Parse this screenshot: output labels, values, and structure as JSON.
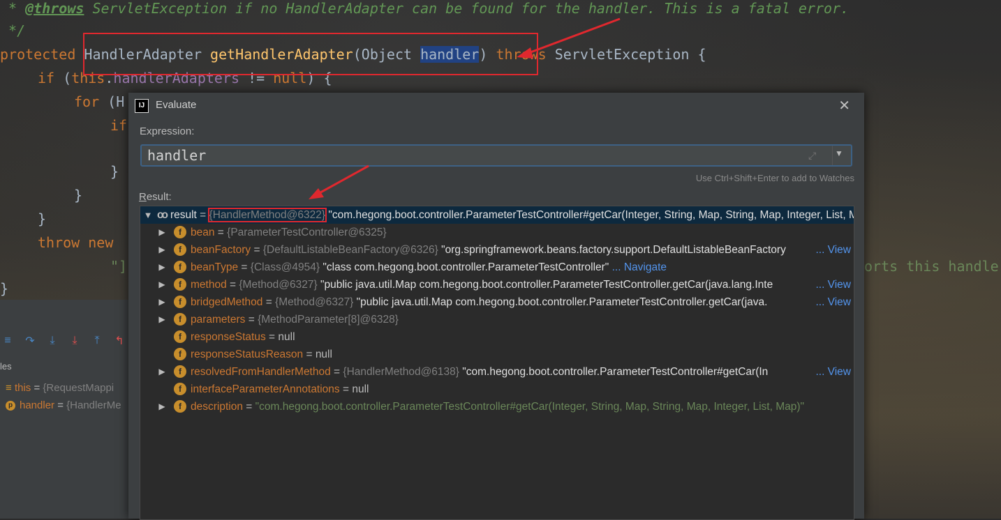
{
  "code": {
    "line1_star": " * ",
    "line1_tag": "@throws",
    "line1_rest": " ServletException if no HandlerAdapter can be found for the handler. This is a fatal error.",
    "line2": " */",
    "line3_kw": "protected",
    "line3_type": " HandlerAdapter ",
    "line3_fn": "getHandlerAdapter",
    "line3_params_open": "(Object ",
    "line3_sel": "handler",
    "line3_close": ") ",
    "line3_throws": "throws",
    "line3_end": " ServletException {",
    "line4_if": "if",
    "line4_mid": " (",
    "line4_this": "this",
    "line4_dot": ".",
    "line4_field": "handlerAdapters",
    "line4_ne": " != ",
    "line4_null": "null",
    "line4_end": ") {",
    "line5_for": "for",
    "line5_rest": " (H",
    "line6_if": "if",
    "line7": "}",
    "line8": "}",
    "line9": "}",
    "line10_throw": "throw",
    "line10_new": "new",
    "line11": "\"]",
    "line11_right": "orts this handle",
    "line12": "}"
  },
  "debug": {
    "vars_header": "les",
    "var_this_name": "this",
    "var_this_eq": " = ",
    "var_this_val": "{RequestMappi",
    "var_handler_name": "handler",
    "var_handler_eq": " = ",
    "var_handler_val": "{HandlerMe"
  },
  "dialog": {
    "title": "Evaluate",
    "logo": "IJ",
    "expression_label": "Expression:",
    "expression_value": "handler",
    "hint": "Use Ctrl+Shift+Enter to add to Watches",
    "result_label_u": "R",
    "result_label_rest": "esult:"
  },
  "tree": {
    "root": {
      "name": "result",
      "eq": " = ",
      "ref": "{HandlerMethod@6322}",
      "value": " \"com.hegong.boot.controller.ParameterTestController#getCar(Integer, String, Map, String, Map, Integer, List, Map)\""
    },
    "rows": [
      {
        "name": "bean",
        "ref": "{ParameterTestController@6325}",
        "value": "",
        "link": "",
        "expandable": true
      },
      {
        "name": "beanFactory",
        "ref": "{DefaultListableBeanFactory@6326}",
        "value": " \"org.springframework.beans.factory.support.DefaultListableBeanFactory",
        "link": "... View",
        "expandable": true
      },
      {
        "name": "beanType",
        "ref": "{Class@4954}",
        "value": " \"class com.hegong.boot.controller.ParameterTestController\"",
        "link": "... Navigate",
        "expandable": true
      },
      {
        "name": "method",
        "ref": "{Method@6327}",
        "value": " \"public java.util.Map com.hegong.boot.controller.ParameterTestController.getCar(java.lang.Inte",
        "link": "... View",
        "expandable": true
      },
      {
        "name": "bridgedMethod",
        "ref": "{Method@6327}",
        "value": " \"public java.util.Map com.hegong.boot.controller.ParameterTestController.getCar(java.",
        "link": "... View",
        "expandable": true
      },
      {
        "name": "parameters",
        "ref": "{MethodParameter[8]@6328}",
        "value": "",
        "link": "",
        "expandable": true
      },
      {
        "name": "responseStatus",
        "ref": "",
        "value": "null",
        "link": "",
        "expandable": false
      },
      {
        "name": "responseStatusReason",
        "ref": "",
        "value": "null",
        "link": "",
        "expandable": false
      },
      {
        "name": "resolvedFromHandlerMethod",
        "ref": "{HandlerMethod@6138}",
        "value": " \"com.hegong.boot.controller.ParameterTestController#getCar(In",
        "link": "... View",
        "expandable": true
      },
      {
        "name": "interfaceParameterAnnotations",
        "ref": "",
        "value": "null",
        "link": "",
        "expandable": false
      },
      {
        "name": "description",
        "ref": "",
        "value": "\"com.hegong.boot.controller.ParameterTestController#getCar(Integer, String, Map, String, Map, Integer, List, Map)\"",
        "link": "",
        "expandable": true
      }
    ]
  },
  "icons": {
    "field": "f",
    "expand": "▶",
    "collapse": "▼",
    "close": "✕",
    "dropdown": "▼",
    "expand_editor": "⤢",
    "param": "p",
    "list": "≡"
  },
  "colors": {
    "keyword": "#cc7832",
    "function": "#ffc66d",
    "comment": "#629755",
    "field_icon": "#c88e2c",
    "link": "#5394ec",
    "annotation_box": "#e0282e",
    "selection": "#0d293e"
  }
}
